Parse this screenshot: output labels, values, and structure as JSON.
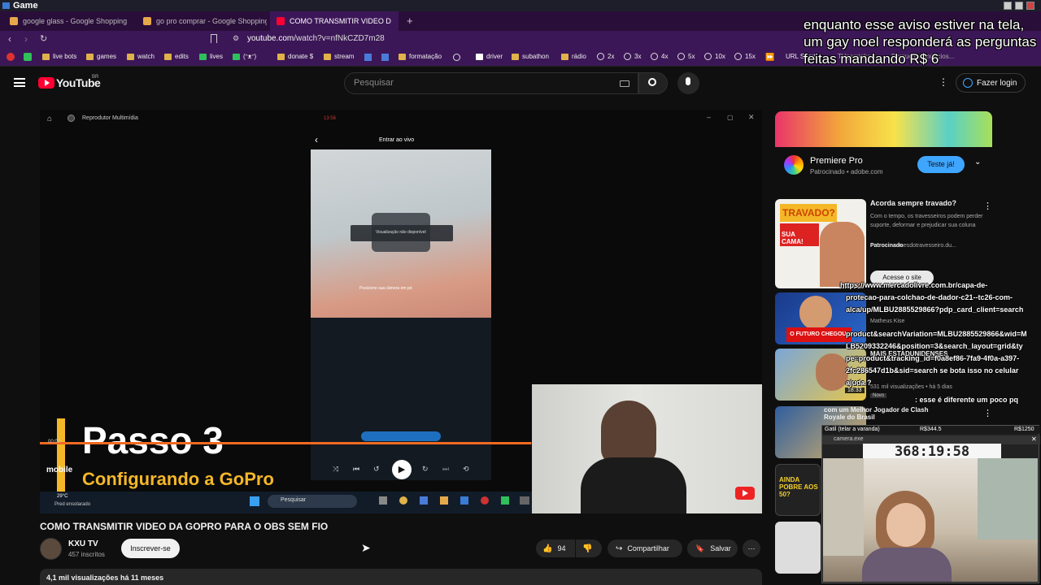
{
  "os": {
    "title": "Game"
  },
  "browser": {
    "tabs": [
      {
        "label": "google glass - Google Shopping",
        "fav": "#e6a94a"
      },
      {
        "label": "go pro comprar - Google Shopping",
        "fav": "#e6a94a"
      },
      {
        "label": "COMO TRANSMITIR VIDEO D",
        "fav": "#ff0033"
      }
    ],
    "url_host": "youtube.com",
    "url_path": "/watch?v=nfNkCZD7m28",
    "bookmarks": [
      "live bots",
      "games",
      "watch",
      "edits",
      "lives",
      "(ᵔᴥᵔ)",
      "donate $",
      "stream",
      "formatação",
      "driver",
      "subathon",
      "rádio",
      "2x",
      "3x",
      "4x",
      "5x",
      "10x",
      "15x",
      "URL Short",
      "TVgaminha",
      "Porque os anúncios..."
    ]
  },
  "overlay": {
    "notice": "enquanto esse aviso estiver na tela, um gay noel responderá as perguntas feitas mandando R$ 6"
  },
  "youtube": {
    "logo": "YouTube",
    "country": "BR",
    "search_placeholder": "Pesquisar",
    "login_label": "Fazer login"
  },
  "player": {
    "app_title": "Reprodutor Multimídia",
    "phone_clock": "13:56",
    "phone_header": "Entrar ao vivo",
    "preview_unavailable": "Visualização não disponível",
    "camera_hint": "Posicione sua câmera em pé.",
    "step_title": "Passo 3",
    "step_subtitle": "Configurando a GoPro",
    "time_left": "00:00",
    "mobile_label": "mobile",
    "weather_temp": "29°C",
    "weather_text": "Pred ensolarado",
    "taskbar_search": "Pesquisar",
    "progress": 0.68
  },
  "video": {
    "title": "COMO TRANSMITIR VIDEO DA GOPRO PARA O OBS SEM FIO",
    "channel": "KXU TV",
    "subscribers": "457 inscritos",
    "subscribe_label": "Inscrever-se",
    "likes": "94",
    "share_label": "Compartilhar",
    "save_label": "Salvar",
    "views_line": "4,1 mil visualizações  há 11 meses"
  },
  "sidebar": {
    "ad": {
      "title": "Premiere Pro",
      "sponsor_line": "Patrocinado • adobe.com",
      "cta": "Teste já!"
    },
    "recs": [
      {
        "title": "Acorda sempre travado?",
        "desc": "Com o tempo, os travesseiros podem perder suporte, deformar e prejudicar sua coluna",
        "sponsor": "Patrocinado",
        "source": "mesdotravesseiro.du...",
        "thumb_text": "TRAVADO?",
        "thumb_sub": "SUA CAMA!",
        "cta": "Acesse o site"
      },
      {
        "channel": "Matheus Kise",
        "thumb_text": "O FUTURO CHEGOU!"
      },
      {
        "title": "MAIS ESTADUNIDENSES",
        "meta": "531 mil visualizações • há 5 dias",
        "duration": "18:33",
        "badge": "Novo"
      },
      {
        "title": "com um Melhor Jogador de Clash Royale do Brasil"
      }
    ]
  },
  "chat": {
    "lines": [
      "https://www.mercadolivre.com.br/capa-de-",
      "protecao-para-colchao-de-dador-c21--tc26-com-",
      "alca/up/MLBU2885529866?pdp_card_client=search",
      "product&searchVariation=MLBU2885529866&wid=M",
      "LB5209332246&position=3&search_layout=grid&ty",
      "pe=product&tracking_id=f0a8ef86-7fa9-4f0a-a397-",
      "2fc286547d1b&sid=search se bota isso no celular",
      "ajuda ?",
      ": esse é diferente um poco pq"
    ]
  },
  "stream_widget": {
    "goal_label": "Gatil (telar a varanda)",
    "goal_current": "R$344.5",
    "goal_target": "R$1250",
    "timer": "368:19:58",
    "cam_label": "camera.exe"
  },
  "colors": {
    "accent": "#3ea6ff",
    "yt_red": "#ff0033",
    "gold": "#f4b728",
    "progress": "#f06a22"
  }
}
